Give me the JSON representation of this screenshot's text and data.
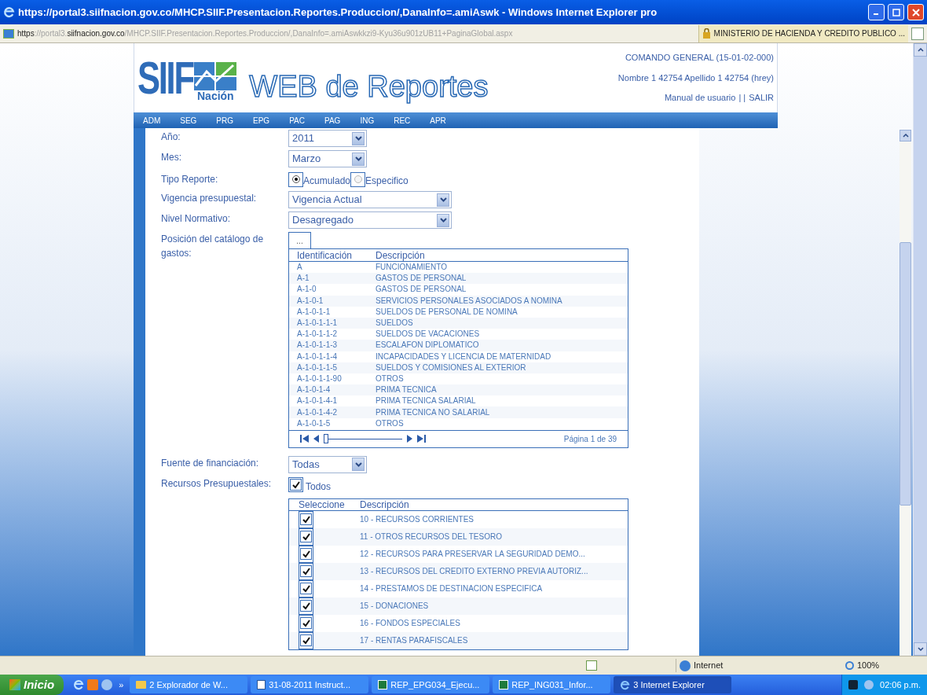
{
  "window": {
    "title": "https://portal3.siifnacion.gov.co/MHCP.SIIF.Presentacion.Reportes.Produccion/,DanaInfo=.amiAswk - Windows Internet Explorer pro"
  },
  "address_bar": {
    "url_parts": [
      {
        "text": "https",
        "kind": "strong"
      },
      {
        "text": "://portal3.",
        "kind": "dim"
      },
      {
        "text": "siifnacion.gov.co",
        "kind": "strong"
      },
      {
        "text": "/MHCP.SIIF.Presentacion.Reportes.Produccion/,DanaInfo=.amiAswkkzi9-Kyu36u901zUB11+PaginaGlobal.aspx",
        "kind": "dim"
      }
    ],
    "site_identity": "MINISTERIO DE HACIENDA Y CREDITO PUBLICO ..."
  },
  "header": {
    "logo_text": "SIIF",
    "logo_subtext": "Nación",
    "site_title": "WEB de Reportes",
    "user_lines": [
      "COMANDO GENERAL (15-01-02-000)",
      "Nombre 1 42754 Apellido 1 42754 (hrey)"
    ],
    "links": [
      "Manual de usuario",
      "| |",
      "SALIR"
    ]
  },
  "nav_menu": [
    "ADM",
    "SEG",
    "PRG",
    "EPG",
    "PAC",
    "PAG",
    "ING",
    "REC",
    "APR"
  ],
  "form": {
    "anio": {
      "label": "Año:",
      "value": "2011"
    },
    "mes": {
      "label": "Mes:",
      "value": "Marzo"
    },
    "tipo_reporte": {
      "label": "Tipo Reporte:",
      "options": [
        {
          "label": "Acumulado",
          "selected": true
        },
        {
          "label": "Especifico",
          "selected": false
        }
      ]
    },
    "vigencia": {
      "label": "Vigencia presupuestal:",
      "value": "Vigencia Actual"
    },
    "nivel": {
      "label": "Nivel Normativo:",
      "value": "Desagregado"
    },
    "catalogo": {
      "label": "Posición del catálogo de gastos:",
      "button": "...",
      "columns": [
        "Identificación",
        "Descripción"
      ],
      "rows": [
        [
          "A",
          "FUNCIONAMIENTO"
        ],
        [
          "A-1",
          "GASTOS DE PERSONAL"
        ],
        [
          "A-1-0",
          "GASTOS DE PERSONAL"
        ],
        [
          "A-1-0-1",
          "SERVICIOS PERSONALES ASOCIADOS A NOMINA"
        ],
        [
          "A-1-0-1-1",
          "SUELDOS DE PERSONAL DE NOMINA"
        ],
        [
          "A-1-0-1-1-1",
          "SUELDOS"
        ],
        [
          "A-1-0-1-1-2",
          "SUELDOS DE VACACIONES"
        ],
        [
          "A-1-0-1-1-3",
          "ESCALAFON DIPLOMATICO"
        ],
        [
          "A-1-0-1-1-4",
          "INCAPACIDADES Y LICENCIA DE MATERNIDAD"
        ],
        [
          "A-1-0-1-1-5",
          "SUELDOS Y COMISIONES AL EXTERIOR"
        ],
        [
          "A-1-0-1-1-90",
          "OTROS"
        ],
        [
          "A-1-0-1-4",
          "PRIMA TECNICA"
        ],
        [
          "A-1-0-1-4-1",
          "PRIMA TECNICA SALARIAL"
        ],
        [
          "A-1-0-1-4-2",
          "PRIMA TECNICA NO SALARIAL"
        ],
        [
          "A-1-0-1-5",
          "OTROS"
        ]
      ],
      "pager": {
        "level": 0.0,
        "page_text": "Página 1 de 39"
      }
    },
    "fuente": {
      "label": "Fuente de financiación:",
      "value": "Todas"
    },
    "recursos": {
      "label": "Recursos Presupuestales:",
      "all_label": "Todos",
      "all_checked": true,
      "columns": [
        "Seleccione",
        "Descripción"
      ],
      "rows": [
        {
          "text": "10 - RECURSOS CORRIENTES",
          "checked": true
        },
        {
          "text": "11 - OTROS RECURSOS DEL TESORO",
          "checked": true
        },
        {
          "text": "12 - RECURSOS PARA PRESERVAR LA SEGURIDAD DEMO...",
          "checked": true
        },
        {
          "text": "13 - RECURSOS DEL CREDITO EXTERNO PREVIA AUTORIZ...",
          "checked": true
        },
        {
          "text": "14 - PRESTAMOS DE DESTINACION ESPECIFICA",
          "checked": true
        },
        {
          "text": "15 - DONACIONES",
          "checked": true
        },
        {
          "text": "16 - FONDOS ESPECIALES",
          "checked": true
        },
        {
          "text": "17 - RENTAS PARAFISCALES",
          "checked": true
        }
      ]
    }
  },
  "status_bar": {
    "zone": "Internet",
    "zoom": "100%"
  },
  "taskbar": {
    "start": "Inicio",
    "overflow": "»",
    "tasks": [
      {
        "label": "2 Explorador de W...",
        "kind": "folder",
        "selected": false
      },
      {
        "label": "31-08-2011 Instruct...",
        "kind": "document",
        "selected": false
      },
      {
        "label": "REP_EPG034_Ejecu...",
        "kind": "spreadsheet",
        "selected": false
      },
      {
        "label": "REP_ING031_Infor...",
        "kind": "spreadsheet",
        "selected": false
      },
      {
        "label": "3 Internet Explorer",
        "kind": "browser",
        "selected": true
      }
    ],
    "clock": "02:06 p.m."
  }
}
